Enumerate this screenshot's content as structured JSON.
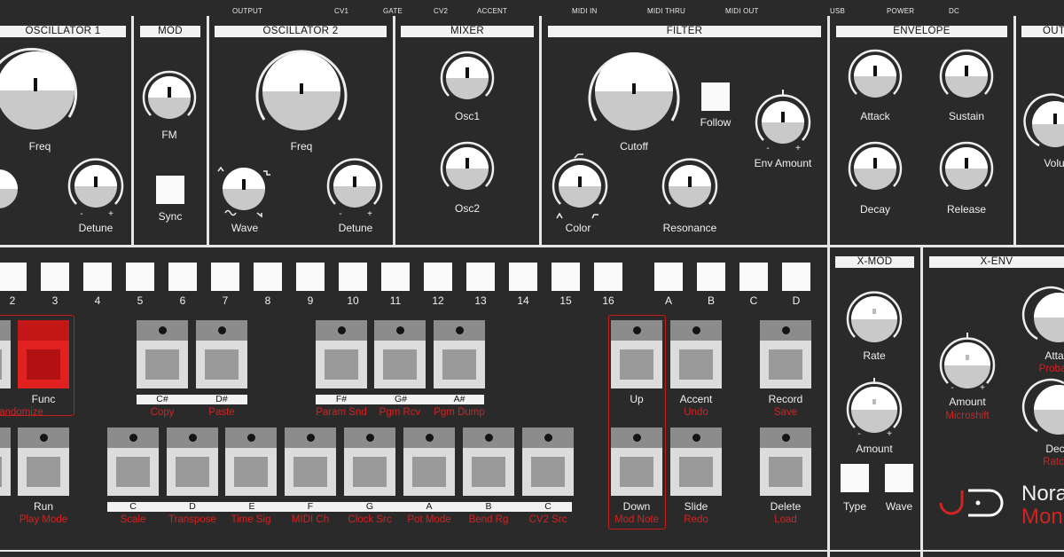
{
  "top_jacks": [
    "OUTPUT",
    "CV1",
    "GATE",
    "CV2",
    "ACCENT",
    "MIDI IN",
    "MIDI THRU",
    "MIDI OUT",
    "USB",
    "POWER",
    "DC"
  ],
  "sections": {
    "osc1": "OSCILLATOR 1",
    "mod": "MOD",
    "osc2": "OSCILLATOR 2",
    "mixer": "MIXER",
    "filter": "FILTER",
    "envelope": "ENVELOPE",
    "output": "OUT",
    "xmod": "X-MOD",
    "xenv": "X-ENV"
  },
  "knobs": {
    "osc1_freq": "Freq",
    "osc1_detune": "Detune",
    "mod_fm": "FM",
    "osc2_freq": "Freq",
    "osc2_wave": "Wave",
    "osc2_detune": "Detune",
    "mixer_osc1": "Osc1",
    "mixer_osc2": "Osc2",
    "filter_cutoff": "Cutoff",
    "filter_color": "Color",
    "filter_resonance": "Resonance",
    "filter_env_amount": "Env Amount",
    "env_attack": "Attack",
    "env_sustain": "Sustain",
    "env_decay": "Decay",
    "env_release": "Release",
    "out_volume": "Volu",
    "xmod_rate": "Rate",
    "xmod_amount": "Amount",
    "xenv_amount": "Amount",
    "xenv_attack": "Atta",
    "xenv_decay": "Dec"
  },
  "minus": "-",
  "plus": "+",
  "switches": {
    "mod_sync": "Sync",
    "filter_follow": "Follow",
    "xmod_type": "Type",
    "xmod_wave": "Wave"
  },
  "steps": [
    "2",
    "3",
    "4",
    "5",
    "6",
    "7",
    "8",
    "9",
    "10",
    "11",
    "12",
    "13",
    "14",
    "15",
    "16",
    "A",
    "B",
    "C",
    "D"
  ],
  "keys": {
    "func": "Func",
    "func_alt": "andomize",
    "run": "Run",
    "run_alt": "Play Mode",
    "up": "Up",
    "accent": "Accent",
    "accent_alt": "Undo",
    "record": "Record",
    "record_alt": "Save",
    "down": "Down",
    "down_alt": "Mod Note",
    "slide": "Slide",
    "slide_alt": "Redo",
    "delete": "Delete",
    "delete_alt": "Load",
    "xenv_microshift": "Microshift",
    "xenv_proba": "Proba",
    "xenv_ratc": "Ratc"
  },
  "sharps": [
    {
      "note": "C#",
      "alt": "Copy"
    },
    {
      "note": "D#",
      "alt": "Paste"
    },
    {
      "note": "F#",
      "alt": "Param Snd"
    },
    {
      "note": "G#",
      "alt": "Pgm Rcv"
    },
    {
      "note": "A#",
      "alt": "Pgm Dump"
    }
  ],
  "naturals": [
    {
      "note": "C",
      "alt": "Scale"
    },
    {
      "note": "D",
      "alt": "Transpose"
    },
    {
      "note": "E",
      "alt": "Time Sig"
    },
    {
      "note": "F",
      "alt": "MIDI Ch"
    },
    {
      "note": "G",
      "alt": "Clock Src"
    },
    {
      "note": "A",
      "alt": "Pot Mode"
    },
    {
      "note": "B",
      "alt": "Bend Rg"
    },
    {
      "note": "C",
      "alt": "CV2 Src"
    }
  ],
  "brand": {
    "line1": "Nora",
    "line2": "Mon"
  },
  "colors": {
    "panel": "#2a2a2a",
    "accent_red": "#d32222",
    "label": "#f0f0f0"
  }
}
